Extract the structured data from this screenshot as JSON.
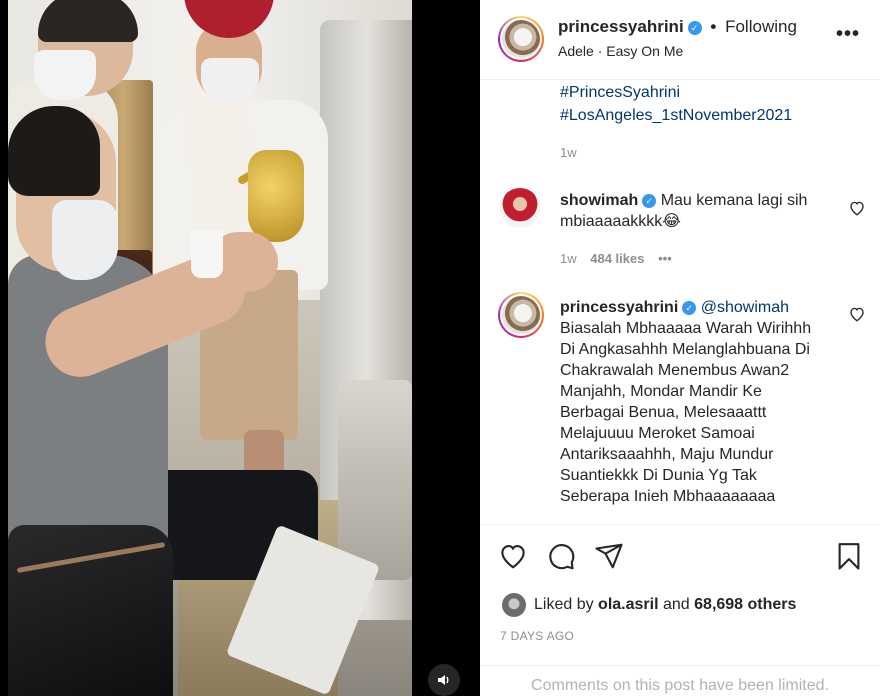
{
  "post_header": {
    "username": "princessyahrini",
    "separator": "•",
    "follow_status": "Following",
    "subtitle": "Adele · Easy On Me"
  },
  "caption_tail": {
    "hashtag_1": "#PrincesSyahrini",
    "hashtag_2": "#LosAngeles_1stNovember2021",
    "time": "1w"
  },
  "comments": [
    {
      "username": "showimah",
      "text": "Mau kemana lagi sih mbiaaaaakkkk😂",
      "time": "1w",
      "likes": "484 likes",
      "more": "•••"
    },
    {
      "username": "princessyahrini",
      "mention": "@showimah",
      "text": "Biasalah Mbhaaaaa Warah Wirihhh Di Angkasahhh Melanglahbuana Di Chakrawalah Menembus Awan2 Manjahh, Mondar Mandir Ke Berbagai Benua, Melesaaattt Melajuuuu Meroket Samoai Antariksaaahhh, Maju Mundur Suantiekkk Di Dunia Yg Tak Seberapa Inieh Mbhaaaaaaaa"
    }
  ],
  "likes_summary": {
    "prefix": "Liked by",
    "liker": "ola.asril",
    "joiner": "and",
    "others": "68,698 others"
  },
  "post_date": "7 DAYS AGO",
  "comments_notice": "Comments on this post have been limited.",
  "colors": {
    "link": "#00376b",
    "verified": "#3897f0",
    "muted": "#8e8e8e"
  },
  "icons": [
    "verified-badge-icon",
    "more-options-icon",
    "heart-icon",
    "comment-icon",
    "share-icon",
    "bookmark-icon",
    "speaker-icon"
  ]
}
